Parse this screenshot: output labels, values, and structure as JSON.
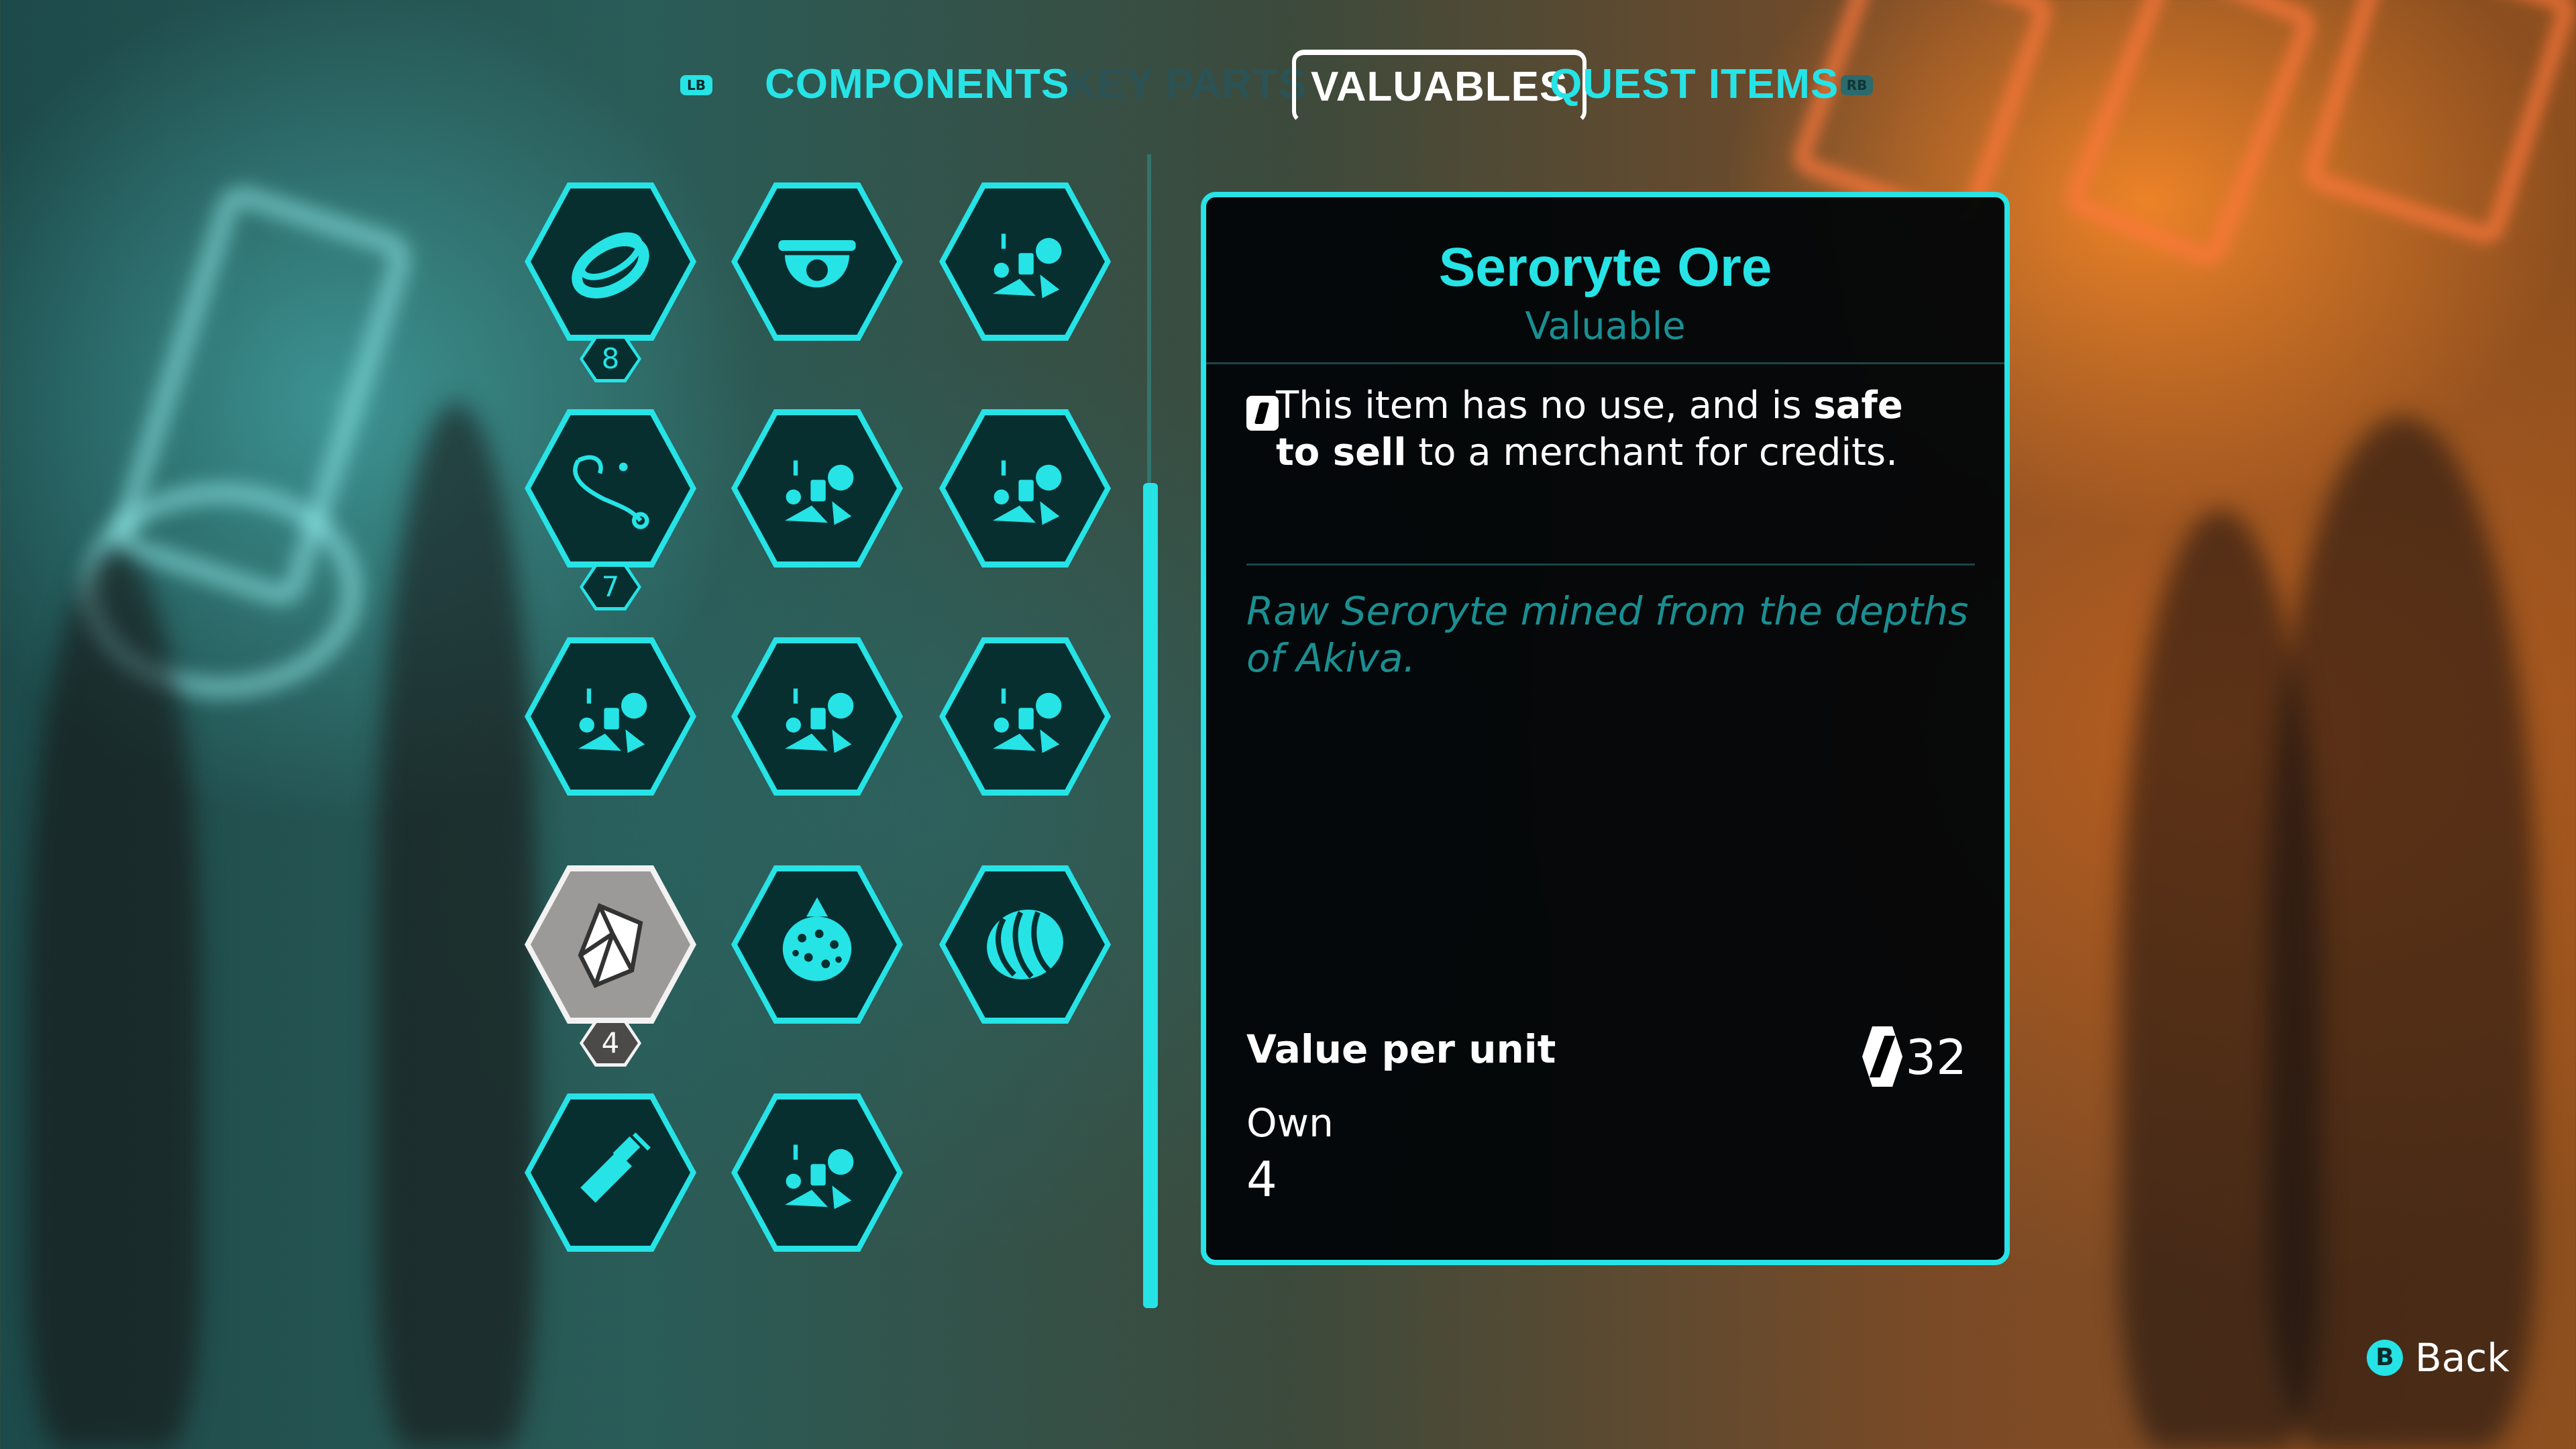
{
  "tabs": {
    "left_shoulder": "LB",
    "right_shoulder": "RB",
    "items": [
      {
        "label": "COMPONENTS"
      },
      {
        "label": "KEY PARTS"
      },
      {
        "label": "VALUABLES"
      },
      {
        "label": "QUEST ITEMS"
      }
    ],
    "active": "VALUABLES"
  },
  "grid": {
    "items": [
      {
        "icon": "ring-icon",
        "count": "8"
      },
      {
        "icon": "dome-sensor-icon"
      },
      {
        "icon": "scrap-pile-icon"
      },
      {
        "icon": "necklace-icon",
        "count": "7"
      },
      {
        "icon": "scrap-pile-icon"
      },
      {
        "icon": "scrap-pile-icon"
      },
      {
        "icon": "scrap-pile-icon"
      },
      {
        "icon": "scrap-pile-icon"
      },
      {
        "icon": "scrap-pile-icon"
      },
      {
        "icon": "crystal-icon",
        "count": "4",
        "selected": true
      },
      {
        "icon": "spiked-egg-icon"
      },
      {
        "icon": "striped-melon-icon"
      },
      {
        "icon": "bottle-icon"
      },
      {
        "icon": "scrap-pile-icon"
      }
    ]
  },
  "detail": {
    "title": "Seroryte Ore",
    "type": "Valuable",
    "usage_pre": "This item has no use, and is ",
    "usage_bold_1": "safe to sell",
    "usage_post": " to a merchant for credits.",
    "flavor": "Raw Seroryte mined from the depths of Akiva.",
    "value_label": "Value per unit",
    "value": "32",
    "own_label": "Own",
    "own_value": "4"
  },
  "footer": {
    "back_button": "B",
    "back_label": "Back"
  },
  "colors": {
    "accent": "#26e3e6",
    "accent_dim": "#1a8f92",
    "panel_bg": "#030608"
  }
}
